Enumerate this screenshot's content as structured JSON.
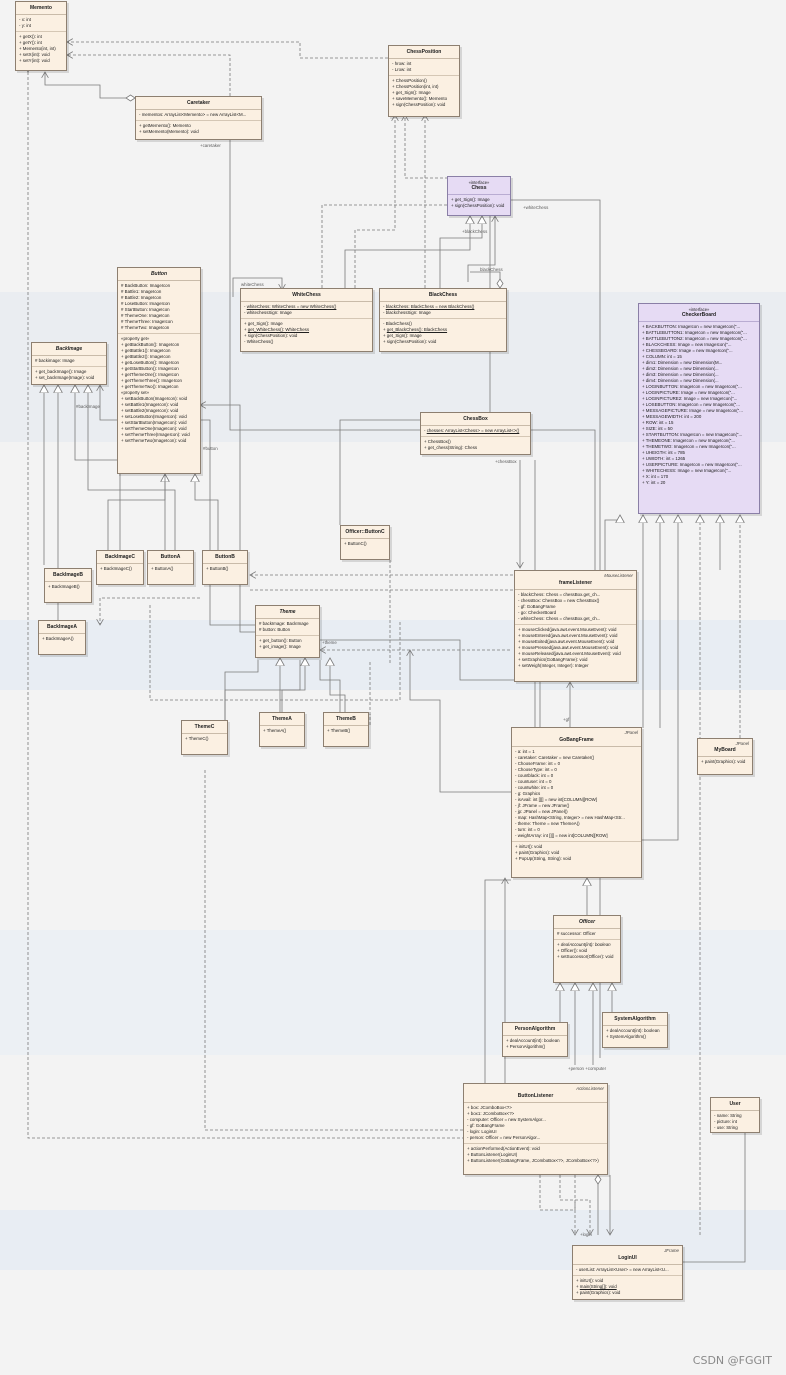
{
  "colors": {
    "class_fill": "#fbf0e2",
    "interface_fill": "#e6dbf4",
    "line": "#7a7a7a",
    "band": "#e7edf3"
  },
  "classes": {
    "memento": {
      "name": "Memento",
      "attrs": [
        "x: int",
        "y: int"
      ],
      "ops": [
        "getX(): int",
        "getY(): int",
        "Memento(int, int)",
        "setX(int): void",
        "setY(int): void"
      ]
    },
    "caretaker": {
      "name": "Caretaker",
      "attrs": [
        "mementos: ArrayList<Memento> = new ArrayList<M..."
      ],
      "ops": [
        "getMemento(): Memento",
        "setMemento(Memento): void"
      ]
    },
    "chessposition": {
      "name": "ChessPosition",
      "attrs": [
        "hrow: int",
        "Lrow: int"
      ],
      "ops": [
        "ChessPosition()",
        "ChessPosition(int, int)",
        "get_Sign(): Image",
        "saveMemento(): Memento",
        "sign(ChessPosition): void"
      ]
    },
    "chess": {
      "stereo": "«interface»",
      "name": "Chess",
      "ops": [
        "get_Sign(): Image",
        "sign(ChessPosition): void"
      ]
    },
    "button": {
      "name": "Button",
      "attrs": [
        "BackButton: ImageIcon",
        "Battle1: ImageIcon",
        "Battle2: ImageIcon",
        "LoseButton: ImageIcon",
        "StartButton: ImageIcon",
        "ThemeOne: ImageIcon",
        "ThemeThree: ImageIcon",
        "ThemeTwo: ImageIcon"
      ],
      "get_header": "«property get»",
      "get_ops": [
        "getBackButton(): ImageIcon",
        "getBattle1(): ImageIcon",
        "getBattle2(): ImageIcon",
        "getLoseButton(): ImageIcon",
        "getStartButton(): ImageIcon",
        "getThemeOne(): ImageIcon",
        "getThemeThree(): ImageIcon",
        "getThemeTwo(): ImageIcon"
      ],
      "set_header": "«property set»",
      "set_ops": [
        "setBackButton(ImageIcon): void",
        "setBattle1(ImageIcon): void",
        "setBattle2(ImageIcon): void",
        "setLoseButton(ImageIcon): void",
        "setStartButton(ImageIcon): void",
        "setThemeOne(ImageIcon): void",
        "setThemeThree(ImageIcon): void",
        "setThemeTwo(ImageIcon): void"
      ]
    },
    "whitechess": {
      "name": "WhiteChess",
      "attrs": [
        "whiteChess: WhiteChess = new WhiteChess()",
        "whitechessSign: Image"
      ],
      "ops": [
        "get_Sign(): Image",
        "get_WhiteChess(): WhiteChess",
        "sign(ChessPosition): void",
        "WhiteChess()"
      ]
    },
    "blackchess": {
      "name": "BlackChess",
      "attrs": [
        "blackChess: BlackChess = new BlackChess()",
        "blackchessSign: Image"
      ],
      "ops": [
        "BlackChess()",
        "get_BlackChess(): BlackChess",
        "get_Sign(): Image",
        "sign(ChessPosition): void"
      ]
    },
    "checkerboard": {
      "stereo": "«interface»",
      "name": "CheckerBoard",
      "attrs": [
        "BACKBUTTON: ImageIcon = new ImageIcon(\"...",
        "BATTLEBUTTON1: ImageIcon = new ImageIcon(\"...",
        "BATTLEBUTTON2: ImageIcon = new ImageIcon(\"...",
        "BLACKCHESS: Image = new ImageIcon(\"...",
        "CHESSBOARD: Image = new ImageIcon(\"...",
        "COLUMN: int = 15",
        "dim1: Dimension = new Dimension(M...",
        "dim2: Dimension = new Dimension(...",
        "dim3: Dimension = new Dimension(...",
        "dim4: Dimension = new Dimension(...",
        "LOGINBUTTON: ImageIcon = new ImageIcon(\"...",
        "LOGINPICTURE: Image = new ImageIcon(\"...",
        "LOGINPICTURE2: Image = new ImageIcon(\"...",
        "LOSEBUTTON: ImageIcon = new ImageIcon(\"...",
        "MESSAGEPICTURE: Image = new ImageIcon(\"...",
        "MESSAGEWIDTH: int = 200",
        "ROW: int = 15",
        "SIZE: int = 50",
        "STARTBUTTON: ImageIcon = new ImageIcon(\"...",
        "THEMEONE: ImageIcon = new ImageIcon(\"...",
        "THEMETWO: ImageIcon = new ImageIcon(\"...",
        "UHEIGTH: int = 785",
        "UWIDTH: int = 1265",
        "USERPICTURE: ImageIcon = new ImageIcon(\"...",
        "WHITECHESS: Image = new ImageIcon(\"...",
        "X: int = 170",
        "Y: int = 20"
      ]
    },
    "backimage": {
      "name": "BackImage",
      "attrs": [
        "backimage: Image"
      ],
      "ops": [
        "get_backImage(): Image",
        "set_backImage(Image): void"
      ]
    },
    "chessbox": {
      "name": "ChessBox",
      "attrs": [
        "chesses: ArrayList<Chess> = new ArrayList<>()"
      ],
      "ops": [
        "ChessBox()",
        "get_chess(String): Chess"
      ]
    },
    "officerbuttonc": {
      "name": "Officer::ButtonC",
      "ops": [
        "ButtonC()"
      ]
    },
    "backimagec": {
      "name": "BackImageC",
      "ops": [
        "BackImageC()"
      ]
    },
    "buttona": {
      "name": "ButtonA",
      "ops": [
        "ButtonA()"
      ]
    },
    "buttonb": {
      "name": "ButtonB",
      "ops": [
        "ButtonB()"
      ]
    },
    "backimageb": {
      "name": "BackImageB",
      "ops": [
        "BackImageB()"
      ]
    },
    "backimagea": {
      "name": "BackImageA",
      "ops": [
        "BackImageA()"
      ]
    },
    "theme": {
      "name": "Theme",
      "attrs": [
        "backImage: BackImage",
        "button: Button"
      ],
      "ops": [
        "get_button(): Button",
        "get_image(): Image"
      ]
    },
    "framelistener": {
      "name": "frameListener",
      "corner": "MouseListener",
      "attrs": [
        "blackChess: Chess = chessBox.get_ch...",
        "chessBox: ChessBox = new ChessBox()",
        "gf: GoBangFrame",
        "go: CheckerBoard",
        "whiteChess: Chess = chessBox.get_ch..."
      ],
      "ops": [
        "mouseClicked(java.awt.event.MouseEvent): void",
        "mouseEntered(java.awt.event.MouseEvent): void",
        "mouseExited(java.awt.event.MouseEvent): void",
        "mousePressed(java.awt.event.MouseEvent): void",
        "mouseReleased(java.awt.event.MouseEvent): void",
        "setGraphics(GoBangFrame): void",
        "setWeigh(Integer, Integer): Integer"
      ]
    },
    "themec": {
      "name": "ThemeC",
      "ops": [
        "ThemeC()"
      ]
    },
    "themea": {
      "name": "ThemeA",
      "ops": [
        "ThemeA()"
      ]
    },
    "themeb": {
      "name": "ThemeB",
      "ops": [
        "ThemeB()"
      ]
    },
    "myboard": {
      "name": "MyBoard",
      "corner": "JPanel",
      "ops": [
        "paint(Graphics): void"
      ]
    },
    "gobangframe": {
      "name": "GoBangFrame",
      "corner": "JPanel",
      "attrs": [
        "a: int = 1",
        "caretaker: Caretaker = new Caretaker()",
        "ChooseFrame: int = 0",
        "ChooseType: int = 0",
        "countblack: int = 0",
        "countuser: int = 0",
        "countwhite: int = 0",
        "g: Graphics",
        "isAvail: int [][] = new int[COLUMN][ROW]",
        "jf: JFrame = new JFrame()",
        "jp: JPanel = new JPanel()",
        "map: HashMap<String, Integer> = new HashMap<Str...",
        "theme: Theme = new ThemeA()",
        "turn: int = 0",
        "weightArray: int [][] = new int[COLUMN][ROW]"
      ],
      "ops": [
        "initUI(): void",
        "paint(Graphics): void",
        "PopUp(String, String): void"
      ]
    },
    "officer": {
      "name": "Officer",
      "attrs": [
        "successor: Officer"
      ],
      "ops": [
        "dealAccount(int): boolean",
        "Officer(): void",
        "setSuccessor(Officer): void"
      ]
    },
    "personalgorithm": {
      "name": "PersonAlgorithm",
      "ops": [
        "dealAccount(int): boolean",
        "PersonAlgorithm()"
      ]
    },
    "systemalgorithm": {
      "name": "SystemAlgorithm",
      "ops": [
        "dealAccount(int): boolean",
        "SystemAlgorithm()"
      ]
    },
    "buttonlistener": {
      "name": "ButtonListener",
      "corner": "ActionListener",
      "attrs": [
        "box: JComboBox<?>",
        "box1: JComboBox<?>",
        "computer: Officer = new SystemAlgor...",
        "gf: GoBangFrame",
        "login: LoginUI",
        "person: Officer = new PersonAlgor..."
      ],
      "ops": [
        "actionPerformed(ActionEvent): void",
        "ButtonListener(LoginUI)",
        "ButtonListener(GoBangFrame, JComboBox<?>, JComboBox<?>)"
      ]
    },
    "user": {
      "name": "User",
      "attrs": [
        "name: String",
        "picture: int",
        "use: String"
      ]
    },
    "loginui": {
      "name": "LoginUI",
      "corner": "JFrame",
      "attrs": [
        "userList: ArrayList<User> = new ArrayList<U..."
      ],
      "ops": [
        "initUI(): void",
        "main(String[]): void",
        "paint(Graphics): void"
      ]
    }
  },
  "labels": {
    "caretaker_role": "+caretaker",
    "whitechess_role": "whiteChess",
    "blackchess_role": "blackChess",
    "whitechess_role2": "+whiteChess",
    "blackchess_role2": "+blackChess",
    "backimage_role": "#backImage",
    "button_role": "#button",
    "chessbox_role": "+chessBox",
    "theme_role": "+theme",
    "gf_role": "+gf",
    "person_computer_role": "+person +computer",
    "login_role": "+login",
    "gf2_role": "+gf"
  },
  "watermark": "CSDN @FGGIT"
}
